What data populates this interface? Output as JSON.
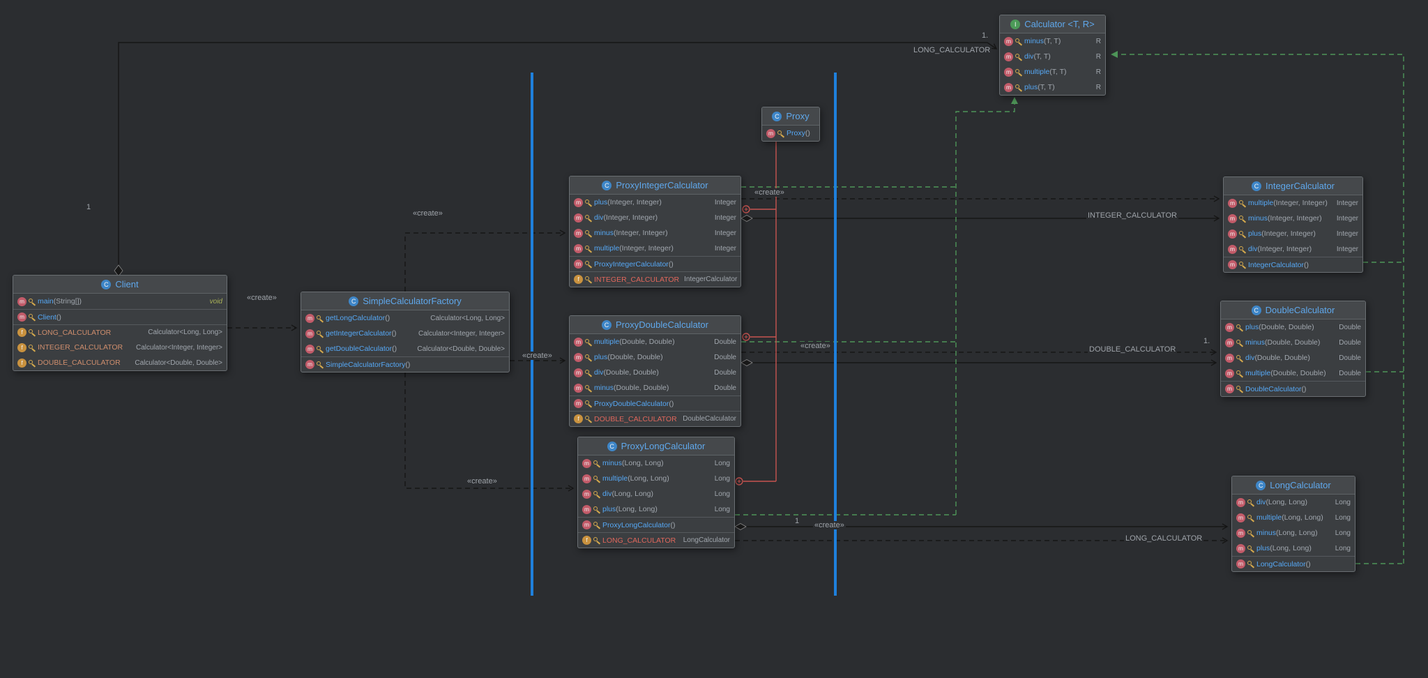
{
  "icon_letters": {
    "method": "m",
    "field": "f"
  },
  "colors": {
    "background": "#2B2D30",
    "node_fill": "#3B3E41",
    "node_header": "#45484B",
    "swimlane_bar": "#1F80DC",
    "realization_edge": "#4E9558",
    "inner_class_edge": "#C75450",
    "method_name": "#56A8F5",
    "field_name": "#CF8E6D",
    "constant_name": "#E0675C",
    "class_title": "#5FA8EC"
  },
  "classes": [
    {
      "id": "client",
      "title": "Client",
      "kind": "class",
      "icon_letter": "C",
      "members": [
        {
          "kind": "method",
          "name": "main",
          "params": "(String[])",
          "rtype": "void",
          "rtype_style": "keyword"
        },
        {
          "kind": "ctor",
          "name": "Client",
          "params": "()",
          "rtype": "",
          "sep": true
        },
        {
          "kind": "field",
          "name": "LONG_CALCULATOR",
          "rtype": "Calculator<Long, Long>",
          "sep": true
        },
        {
          "kind": "field",
          "name": "INTEGER_CALCULATOR",
          "rtype": "Calculator<Integer, Integer>"
        },
        {
          "kind": "field",
          "name": "DOUBLE_CALCULATOR",
          "rtype": "Calculator<Double, Double>"
        }
      ]
    },
    {
      "id": "factory",
      "title": "SimpleCalculatorFactory",
      "kind": "class",
      "icon_letter": "C",
      "members": [
        {
          "kind": "method",
          "name": "getLongCalculator",
          "params": "()",
          "rtype": "Calculator<Long, Long>"
        },
        {
          "kind": "method",
          "name": "getIntegerCalculator",
          "params": "()",
          "rtype": "Calculator<Integer, Integer>"
        },
        {
          "kind": "method",
          "name": "getDoubleCalculator",
          "params": "()",
          "rtype": "Calculator<Double, Double>"
        },
        {
          "kind": "ctor",
          "name": "SimpleCalculatorFactory",
          "params": "()",
          "rtype": "",
          "sep": true
        }
      ]
    },
    {
      "id": "proxy",
      "title": "Proxy",
      "kind": "class",
      "icon_letter": "C",
      "members": [
        {
          "kind": "ctor",
          "name": "Proxy",
          "params": "()",
          "rtype": ""
        }
      ]
    },
    {
      "id": "proxyInteger",
      "title": "ProxyIntegerCalculator",
      "kind": "class",
      "icon_letter": "C",
      "members": [
        {
          "kind": "method",
          "name": "plus",
          "params": "(Integer, Integer)",
          "rtype": "Integer"
        },
        {
          "kind": "method",
          "name": "div",
          "params": "(Integer, Integer)",
          "rtype": "Integer"
        },
        {
          "kind": "method",
          "name": "minus",
          "params": "(Integer, Integer)",
          "rtype": "Integer"
        },
        {
          "kind": "method",
          "name": "multiple",
          "params": "(Integer, Integer)",
          "rtype": "Integer"
        },
        {
          "kind": "ctor",
          "name": "ProxyIntegerCalculator",
          "params": "()",
          "rtype": "",
          "sep": true
        },
        {
          "kind": "field",
          "name_style": "red",
          "name": "INTEGER_CALCULATOR",
          "rtype": "IntegerCalculator",
          "sep": true
        }
      ]
    },
    {
      "id": "proxyDouble",
      "title": "ProxyDoubleCalculator",
      "kind": "class",
      "icon_letter": "C",
      "members": [
        {
          "kind": "method",
          "name": "multiple",
          "params": "(Double, Double)",
          "rtype": "Double"
        },
        {
          "kind": "method",
          "name": "plus",
          "params": "(Double, Double)",
          "rtype": "Double"
        },
        {
          "kind": "method",
          "name": "div",
          "params": "(Double, Double)",
          "rtype": "Double"
        },
        {
          "kind": "method",
          "name": "minus",
          "params": "(Double, Double)",
          "rtype": "Double"
        },
        {
          "kind": "ctor",
          "name": "ProxyDoubleCalculator",
          "params": "()",
          "rtype": "",
          "sep": true
        },
        {
          "kind": "field",
          "name_style": "red",
          "name": "DOUBLE_CALCULATOR",
          "rtype": "DoubleCalculator",
          "sep": true
        }
      ]
    },
    {
      "id": "proxyLong",
      "title": "ProxyLongCalculator",
      "kind": "class",
      "icon_letter": "C",
      "members": [
        {
          "kind": "method",
          "name": "minus",
          "params": "(Long, Long)",
          "rtype": "Long"
        },
        {
          "kind": "method",
          "name": "multiple",
          "params": "(Long, Long)",
          "rtype": "Long"
        },
        {
          "kind": "method",
          "name": "div",
          "params": "(Long, Long)",
          "rtype": "Long"
        },
        {
          "kind": "method",
          "name": "plus",
          "params": "(Long, Long)",
          "rtype": "Long"
        },
        {
          "kind": "ctor",
          "name": "ProxyLongCalculator",
          "params": "()",
          "rtype": "",
          "sep": true
        },
        {
          "kind": "field",
          "name_style": "red",
          "name": "LONG_CALCULATOR",
          "rtype": "LongCalculator",
          "sep": true
        }
      ]
    },
    {
      "id": "calculator",
      "title": "Calculator <T, R>",
      "kind": "interface",
      "icon_letter": "I",
      "members": [
        {
          "kind": "method",
          "name": "minus",
          "params": "(T, T)",
          "rtype": "R"
        },
        {
          "kind": "method",
          "name": "div",
          "params": "(T, T)",
          "rtype": "R"
        },
        {
          "kind": "method",
          "name": "multiple",
          "params": "(T, T)",
          "rtype": "R"
        },
        {
          "kind": "method",
          "name": "plus",
          "params": "(T, T)",
          "rtype": "R"
        }
      ]
    },
    {
      "id": "integerCalc",
      "title": "IntegerCalculator",
      "kind": "class",
      "icon_letter": "C",
      "members": [
        {
          "kind": "method",
          "name": "multiple",
          "params": "(Integer, Integer)",
          "rtype": "Integer"
        },
        {
          "kind": "method",
          "name": "minus",
          "params": "(Integer, Integer)",
          "rtype": "Integer"
        },
        {
          "kind": "method",
          "name": "plus",
          "params": "(Integer, Integer)",
          "rtype": "Integer"
        },
        {
          "kind": "method",
          "name": "div",
          "params": "(Integer, Integer)",
          "rtype": "Integer"
        },
        {
          "kind": "ctor",
          "name": "IntegerCalculator",
          "params": "()",
          "rtype": "",
          "sep": true
        }
      ]
    },
    {
      "id": "doubleCalc",
      "title": "DoubleCalculator",
      "kind": "class",
      "icon_letter": "C",
      "members": [
        {
          "kind": "method",
          "name": "plus",
          "params": "(Double, Double)",
          "rtype": "Double"
        },
        {
          "kind": "method",
          "name": "minus",
          "params": "(Double, Double)",
          "rtype": "Double"
        },
        {
          "kind": "method",
          "name": "div",
          "params": "(Double, Double)",
          "rtype": "Double"
        },
        {
          "kind": "method",
          "name": "multiple",
          "params": "(Double, Double)",
          "rtype": "Double"
        },
        {
          "kind": "ctor",
          "name": "DoubleCalculator",
          "params": "()",
          "rtype": "",
          "sep": true
        }
      ]
    },
    {
      "id": "longCalc",
      "title": "LongCalculator",
      "kind": "class",
      "icon_letter": "C",
      "members": [
        {
          "kind": "method",
          "name": "div",
          "params": "(Long, Long)",
          "rtype": "Long"
        },
        {
          "kind": "method",
          "name": "multiple",
          "params": "(Long, Long)",
          "rtype": "Long"
        },
        {
          "kind": "method",
          "name": "minus",
          "params": "(Long, Long)",
          "rtype": "Long"
        },
        {
          "kind": "method",
          "name": "plus",
          "params": "(Long, Long)",
          "rtype": "Long"
        },
        {
          "kind": "ctor",
          "name": "LongCalculator",
          "params": "()",
          "rtype": "",
          "sep": true
        }
      ]
    }
  ],
  "edge_labels": [
    {
      "id": "create-client-factory",
      "text": "«create»"
    },
    {
      "id": "create-factory-integer",
      "text": "«create»"
    },
    {
      "id": "create-factory-double",
      "text": "«create»"
    },
    {
      "id": "create-factory-long",
      "text": "«create»"
    },
    {
      "id": "create-proxy-integer",
      "text": "«create»"
    },
    {
      "id": "create-proxy-double",
      "text": "«create»"
    },
    {
      "id": "create-proxy-long",
      "text": "«create»"
    },
    {
      "id": "assoc-long-calculator-top",
      "text": "LONG_CALCULATOR"
    },
    {
      "id": "assoc-integer-calculator",
      "text": "INTEGER_CALCULATOR"
    },
    {
      "id": "assoc-double-calculator",
      "text": "DOUBLE_CALCULATOR"
    },
    {
      "id": "assoc-long-calculator-bottom",
      "text": "LONG_CALCULATOR"
    },
    {
      "id": "mult-client-1",
      "text": "1"
    },
    {
      "id": "mult-calculator",
      "text": "1."
    },
    {
      "id": "mult-double",
      "text": "1."
    },
    {
      "id": "mult-long",
      "text": "1"
    }
  ]
}
